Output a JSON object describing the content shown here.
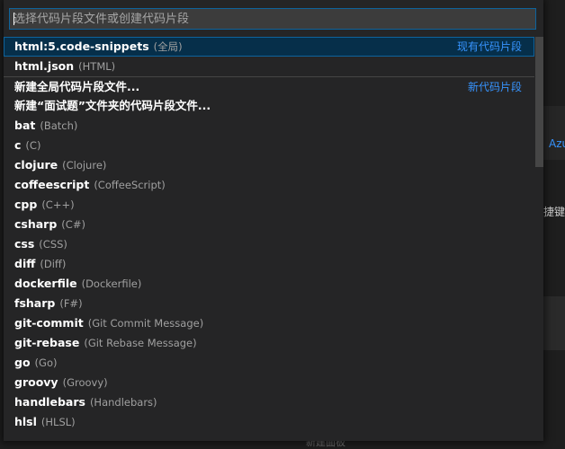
{
  "background": {
    "azure_text": "Azu",
    "shortcut_text": "捷键",
    "bottom_text": "新建面板"
  },
  "quick_pick": {
    "placeholder": "选择代码片段文件或创建代码片段",
    "items": [
      {
        "label": "html:5.code-snippets",
        "desc": "(全局)",
        "group": "现有代码片段",
        "selected": true,
        "separator": false
      },
      {
        "label": "html.json",
        "desc": "(HTML)",
        "group": "",
        "selected": false,
        "separator": false
      },
      {
        "label": "新建全局代码片段文件...",
        "desc": "",
        "group": "新代码片段",
        "selected": false,
        "separator": true
      },
      {
        "label": "新建“面试题”文件夹的代码片段文件...",
        "desc": "",
        "group": "",
        "selected": false,
        "separator": false
      },
      {
        "label": "bat",
        "desc": "(Batch)",
        "group": "",
        "selected": false,
        "separator": false
      },
      {
        "label": "c",
        "desc": "(C)",
        "group": "",
        "selected": false,
        "separator": false
      },
      {
        "label": "clojure",
        "desc": "(Clojure)",
        "group": "",
        "selected": false,
        "separator": false
      },
      {
        "label": "coffeescript",
        "desc": "(CoffeeScript)",
        "group": "",
        "selected": false,
        "separator": false
      },
      {
        "label": "cpp",
        "desc": "(C++)",
        "group": "",
        "selected": false,
        "separator": false
      },
      {
        "label": "csharp",
        "desc": "(C#)",
        "group": "",
        "selected": false,
        "separator": false
      },
      {
        "label": "css",
        "desc": "(CSS)",
        "group": "",
        "selected": false,
        "separator": false
      },
      {
        "label": "diff",
        "desc": "(Diff)",
        "group": "",
        "selected": false,
        "separator": false
      },
      {
        "label": "dockerfile",
        "desc": "(Dockerfile)",
        "group": "",
        "selected": false,
        "separator": false
      },
      {
        "label": "fsharp",
        "desc": "(F#)",
        "group": "",
        "selected": false,
        "separator": false
      },
      {
        "label": "git-commit",
        "desc": "(Git Commit Message)",
        "group": "",
        "selected": false,
        "separator": false
      },
      {
        "label": "git-rebase",
        "desc": "(Git Rebase Message)",
        "group": "",
        "selected": false,
        "separator": false
      },
      {
        "label": "go",
        "desc": "(Go)",
        "group": "",
        "selected": false,
        "separator": false
      },
      {
        "label": "groovy",
        "desc": "(Groovy)",
        "group": "",
        "selected": false,
        "separator": false
      },
      {
        "label": "handlebars",
        "desc": "(Handlebars)",
        "group": "",
        "selected": false,
        "separator": false
      },
      {
        "label": "hlsl",
        "desc": "(HLSL)",
        "group": "",
        "selected": false,
        "separator": false
      }
    ]
  },
  "colors": {
    "accent": "#0e639c",
    "group_label": "#3794ff",
    "selected_bg": "#062f4a"
  }
}
